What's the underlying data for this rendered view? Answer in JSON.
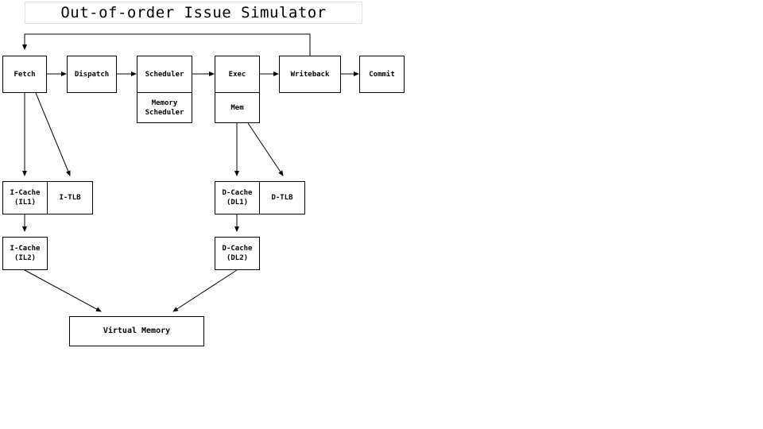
{
  "title": {
    "text": "Out-of-order Issue Simulator"
  },
  "pipeline": {
    "stages": [
      {
        "id": "fetch",
        "label": "Fetch"
      },
      {
        "id": "dispatch",
        "label": "Dispatch"
      },
      {
        "id": "scheduler",
        "label": "Scheduler"
      },
      {
        "id": "exec",
        "label": "Exec"
      },
      {
        "id": "writeback",
        "label": "Writeback"
      },
      {
        "id": "commit",
        "label": "Commit"
      }
    ],
    "substages": [
      {
        "id": "memory-scheduler",
        "label_line1": "Memory",
        "label_line2": "Scheduler"
      },
      {
        "id": "mem",
        "label": "Mem"
      }
    ]
  },
  "memory": {
    "icache_l1": {
      "label_line1": "I-Cache",
      "label_line2": "(IL1)"
    },
    "itlb": {
      "label": "I-TLB"
    },
    "icache_l2": {
      "label_line1": "I-Cache",
      "label_line2": "(IL2)"
    },
    "dcache_l1": {
      "label_line1": "D-Cache",
      "label_line2": "(DL1)"
    },
    "dtlb": {
      "label": "D-TLB"
    },
    "dcache_l2": {
      "label_line1": "D-Cache",
      "label_line2": "(DL2)"
    },
    "virtual_memory": {
      "label": "Virtual Memory"
    }
  },
  "colors": {
    "background": "#ffffff",
    "stroke": "#000000",
    "title_border": "#e2e2e2"
  },
  "edges": [
    {
      "id": "fetch-to-dispatch",
      "from": "fetch",
      "to": "dispatch",
      "kind": "arrow"
    },
    {
      "id": "dispatch-to-scheduler",
      "from": "dispatch",
      "to": "scheduler",
      "kind": "arrow"
    },
    {
      "id": "scheduler-to-exec",
      "from": "scheduler",
      "to": "exec",
      "kind": "arrow"
    },
    {
      "id": "exec-to-writeback",
      "from": "exec",
      "to": "writeback",
      "kind": "arrow"
    },
    {
      "id": "writeback-to-commit",
      "from": "writeback",
      "to": "commit",
      "kind": "arrow"
    },
    {
      "id": "writeback-to-fetch-feedback",
      "from": "writeback",
      "to": "fetch",
      "kind": "feedback"
    },
    {
      "id": "fetch-to-icache-l1",
      "from": "fetch",
      "to": "icache_l1",
      "kind": "arrow"
    },
    {
      "id": "fetch-to-itlb",
      "from": "fetch",
      "to": "itlb",
      "kind": "arrow"
    },
    {
      "id": "icache-l1-to-icache-l2",
      "from": "icache_l1",
      "to": "icache_l2",
      "kind": "arrow"
    },
    {
      "id": "mem-to-dcache-l1",
      "from": "mem",
      "to": "dcache_l1",
      "kind": "arrow"
    },
    {
      "id": "mem-to-dtlb",
      "from": "mem",
      "to": "dtlb",
      "kind": "arrow"
    },
    {
      "id": "dcache-l1-to-dcache-l2",
      "from": "dcache_l1",
      "to": "dcache_l2",
      "kind": "arrow"
    },
    {
      "id": "icache-l2-to-virtual-memory",
      "from": "icache_l2",
      "to": "virtual_memory",
      "kind": "arrow"
    },
    {
      "id": "dcache-l2-to-virtual-memory",
      "from": "dcache_l2",
      "to": "virtual_memory",
      "kind": "arrow"
    }
  ]
}
